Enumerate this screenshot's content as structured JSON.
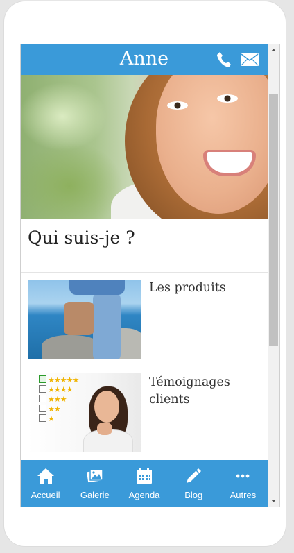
{
  "header": {
    "title": "Anne",
    "phone_icon": "phone-icon",
    "mail_icon": "mail-icon",
    "color": "#3a9ad9"
  },
  "intro": {
    "title": "Qui suis-je ?"
  },
  "cards": [
    {
      "label": "Les produits"
    },
    {
      "label": "Témoignages clients"
    }
  ],
  "nav": {
    "items": [
      {
        "label": "Accueil",
        "icon": "home-icon"
      },
      {
        "label": "Galerie",
        "icon": "gallery-icon"
      },
      {
        "label": "Agenda",
        "icon": "calendar-icon"
      },
      {
        "label": "Blog",
        "icon": "pencil-icon"
      },
      {
        "label": "Autres",
        "icon": "more-icon"
      }
    ]
  }
}
